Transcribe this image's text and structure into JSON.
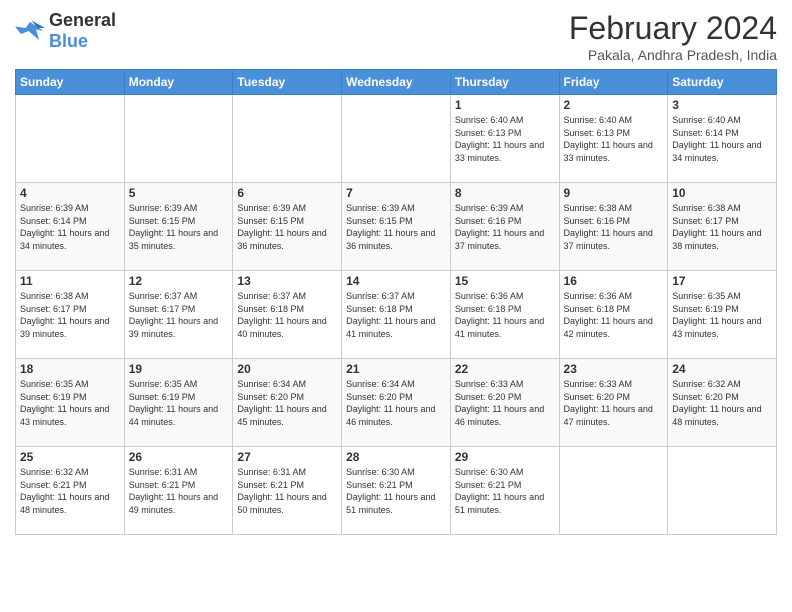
{
  "logo": {
    "general": "General",
    "blue": "Blue"
  },
  "title": "February 2024",
  "subtitle": "Pakala, Andhra Pradesh, India",
  "days_of_week": [
    "Sunday",
    "Monday",
    "Tuesday",
    "Wednesday",
    "Thursday",
    "Friday",
    "Saturday"
  ],
  "weeks": [
    [
      {
        "day": "",
        "info": ""
      },
      {
        "day": "",
        "info": ""
      },
      {
        "day": "",
        "info": ""
      },
      {
        "day": "",
        "info": ""
      },
      {
        "day": "1",
        "info": "Sunrise: 6:40 AM\nSunset: 6:13 PM\nDaylight: 11 hours and 33 minutes."
      },
      {
        "day": "2",
        "info": "Sunrise: 6:40 AM\nSunset: 6:13 PM\nDaylight: 11 hours and 33 minutes."
      },
      {
        "day": "3",
        "info": "Sunrise: 6:40 AM\nSunset: 6:14 PM\nDaylight: 11 hours and 34 minutes."
      }
    ],
    [
      {
        "day": "4",
        "info": "Sunrise: 6:39 AM\nSunset: 6:14 PM\nDaylight: 11 hours and 34 minutes."
      },
      {
        "day": "5",
        "info": "Sunrise: 6:39 AM\nSunset: 6:15 PM\nDaylight: 11 hours and 35 minutes."
      },
      {
        "day": "6",
        "info": "Sunrise: 6:39 AM\nSunset: 6:15 PM\nDaylight: 11 hours and 36 minutes."
      },
      {
        "day": "7",
        "info": "Sunrise: 6:39 AM\nSunset: 6:15 PM\nDaylight: 11 hours and 36 minutes."
      },
      {
        "day": "8",
        "info": "Sunrise: 6:39 AM\nSunset: 6:16 PM\nDaylight: 11 hours and 37 minutes."
      },
      {
        "day": "9",
        "info": "Sunrise: 6:38 AM\nSunset: 6:16 PM\nDaylight: 11 hours and 37 minutes."
      },
      {
        "day": "10",
        "info": "Sunrise: 6:38 AM\nSunset: 6:17 PM\nDaylight: 11 hours and 38 minutes."
      }
    ],
    [
      {
        "day": "11",
        "info": "Sunrise: 6:38 AM\nSunset: 6:17 PM\nDaylight: 11 hours and 39 minutes."
      },
      {
        "day": "12",
        "info": "Sunrise: 6:37 AM\nSunset: 6:17 PM\nDaylight: 11 hours and 39 minutes."
      },
      {
        "day": "13",
        "info": "Sunrise: 6:37 AM\nSunset: 6:18 PM\nDaylight: 11 hours and 40 minutes."
      },
      {
        "day": "14",
        "info": "Sunrise: 6:37 AM\nSunset: 6:18 PM\nDaylight: 11 hours and 41 minutes."
      },
      {
        "day": "15",
        "info": "Sunrise: 6:36 AM\nSunset: 6:18 PM\nDaylight: 11 hours and 41 minutes."
      },
      {
        "day": "16",
        "info": "Sunrise: 6:36 AM\nSunset: 6:18 PM\nDaylight: 11 hours and 42 minutes."
      },
      {
        "day": "17",
        "info": "Sunrise: 6:35 AM\nSunset: 6:19 PM\nDaylight: 11 hours and 43 minutes."
      }
    ],
    [
      {
        "day": "18",
        "info": "Sunrise: 6:35 AM\nSunset: 6:19 PM\nDaylight: 11 hours and 43 minutes."
      },
      {
        "day": "19",
        "info": "Sunrise: 6:35 AM\nSunset: 6:19 PM\nDaylight: 11 hours and 44 minutes."
      },
      {
        "day": "20",
        "info": "Sunrise: 6:34 AM\nSunset: 6:20 PM\nDaylight: 11 hours and 45 minutes."
      },
      {
        "day": "21",
        "info": "Sunrise: 6:34 AM\nSunset: 6:20 PM\nDaylight: 11 hours and 46 minutes."
      },
      {
        "day": "22",
        "info": "Sunrise: 6:33 AM\nSunset: 6:20 PM\nDaylight: 11 hours and 46 minutes."
      },
      {
        "day": "23",
        "info": "Sunrise: 6:33 AM\nSunset: 6:20 PM\nDaylight: 11 hours and 47 minutes."
      },
      {
        "day": "24",
        "info": "Sunrise: 6:32 AM\nSunset: 6:20 PM\nDaylight: 11 hours and 48 minutes."
      }
    ],
    [
      {
        "day": "25",
        "info": "Sunrise: 6:32 AM\nSunset: 6:21 PM\nDaylight: 11 hours and 48 minutes."
      },
      {
        "day": "26",
        "info": "Sunrise: 6:31 AM\nSunset: 6:21 PM\nDaylight: 11 hours and 49 minutes."
      },
      {
        "day": "27",
        "info": "Sunrise: 6:31 AM\nSunset: 6:21 PM\nDaylight: 11 hours and 50 minutes."
      },
      {
        "day": "28",
        "info": "Sunrise: 6:30 AM\nSunset: 6:21 PM\nDaylight: 11 hours and 51 minutes."
      },
      {
        "day": "29",
        "info": "Sunrise: 6:30 AM\nSunset: 6:21 PM\nDaylight: 11 hours and 51 minutes."
      },
      {
        "day": "",
        "info": ""
      },
      {
        "day": "",
        "info": ""
      }
    ]
  ]
}
